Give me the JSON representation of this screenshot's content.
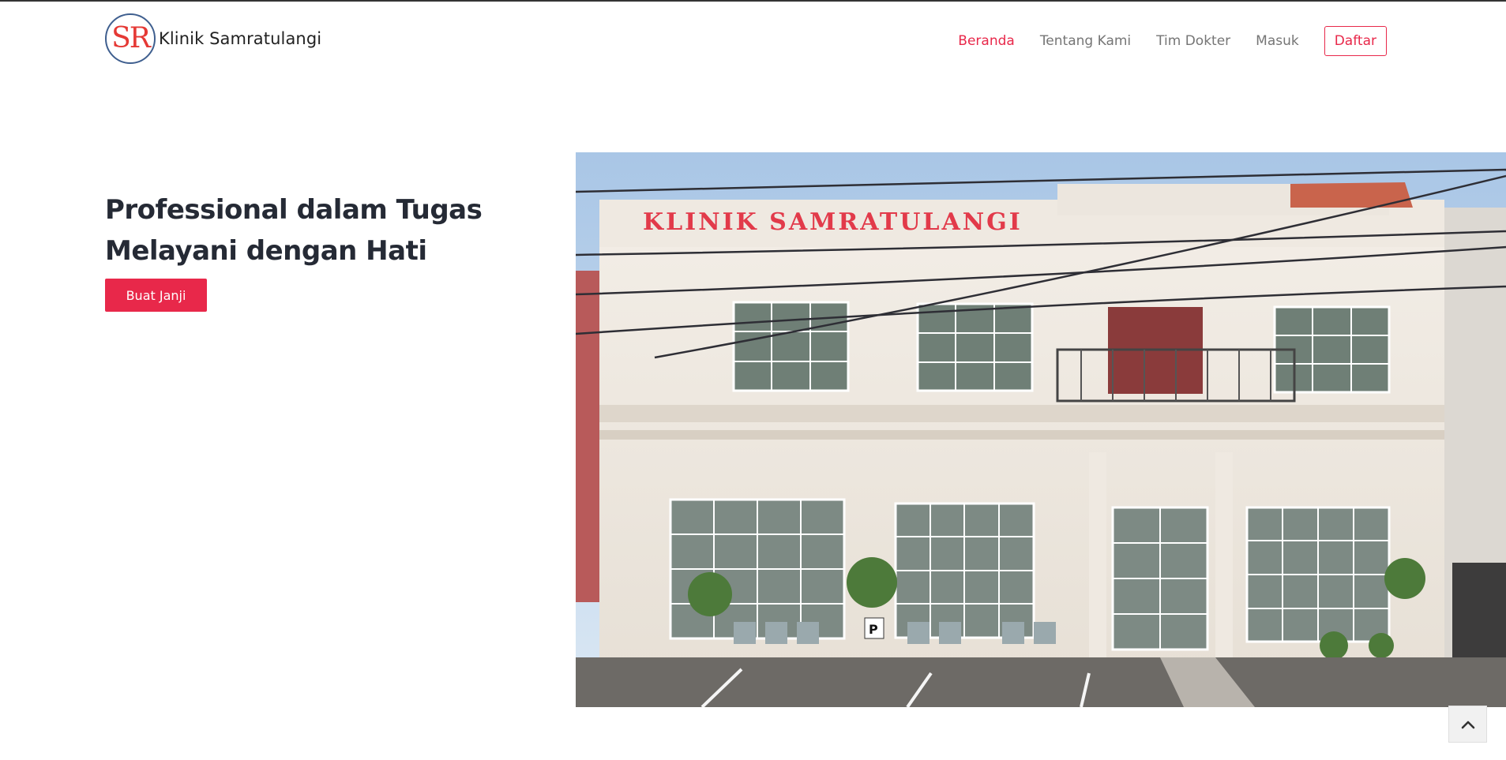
{
  "header": {
    "logo_text": "SR",
    "brand_name": "Klinik Samratulangi",
    "nav": [
      {
        "label": "Beranda",
        "active": true
      },
      {
        "label": "Tentang Kami",
        "active": false
      },
      {
        "label": "Tim Dokter",
        "active": false
      },
      {
        "label": "Masuk",
        "active": false
      }
    ],
    "register_label": "Daftar"
  },
  "hero": {
    "title_line1": "Professional dalam Tugas",
    "title_line2": "Melayani dengan Hati",
    "cta_label": "Buat Janji",
    "photo_sign": "KLINIK SAMRATULANGI",
    "parking_sign": "P"
  },
  "colors": {
    "accent": "#e8284a",
    "heading": "#252a35",
    "nav_text": "#757575"
  },
  "icons": {
    "scroll_top": "chevron-up-icon"
  }
}
